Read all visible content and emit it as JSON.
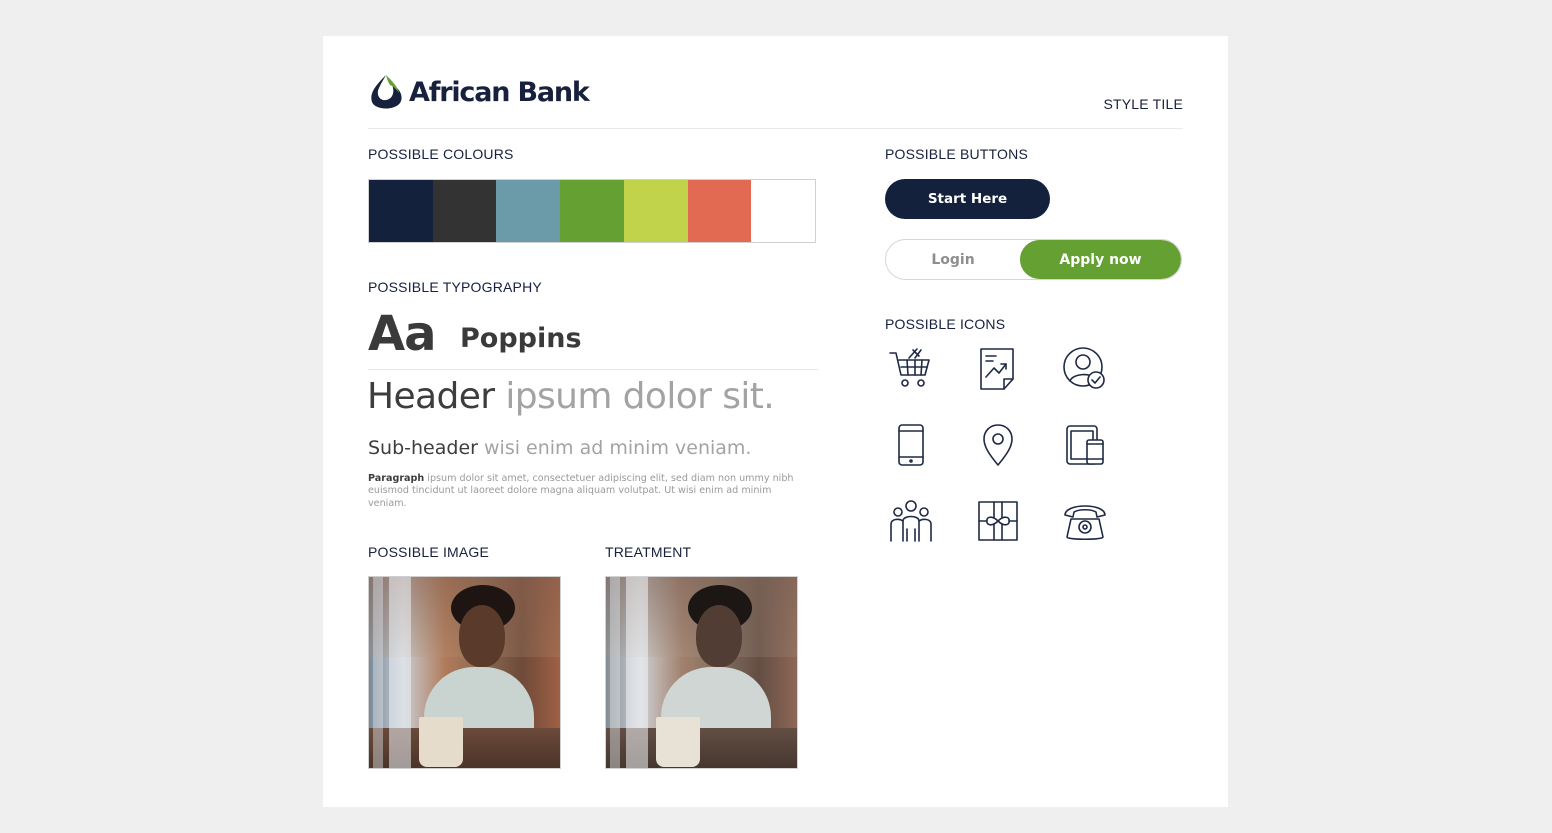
{
  "brand": {
    "name": "African Bank",
    "logo_colors": [
      "#17213d",
      "#64a032"
    ]
  },
  "tile_label": "STYLE TILE",
  "colours": {
    "label": "POSSIBLE COLOURS",
    "swatches": [
      "#13213d",
      "#333333",
      "#6b9ba9",
      "#64a032",
      "#c0d34a",
      "#e26a52",
      "#ffffff"
    ]
  },
  "typography": {
    "label": "POSSIBLE TYPOGRAPHY",
    "sample_glyph": "Aa",
    "font_name": "Poppins",
    "header_dark": "Header",
    "header_light": "ipsum dolor sit.",
    "sub_dark": "Sub-header",
    "sub_light": "wisi enim ad minim veniam.",
    "para_dark": "Paragraph",
    "para_light": "ipsum dolor sit amet, consectetuer adipiscing elit, sed diam non ummy nibh euismod tincidunt ut laoreet dolore magna aliquam volutpat. Ut wisi enim ad minim veniam."
  },
  "image": {
    "label": "POSSIBLE IMAGE"
  },
  "treatment": {
    "label": "TREATMENT"
  },
  "buttons": {
    "label": "POSSIBLE BUTTONS",
    "primary": "Start Here",
    "login": "Login",
    "apply": "Apply now",
    "primary_color": "#13213d",
    "apply_color": "#64a032"
  },
  "icons": {
    "label": "POSSIBLE ICONS",
    "items": [
      "shopping-cart-icon",
      "report-chart-icon",
      "user-check-icon",
      "mobile-phone-icon",
      "location-pin-icon",
      "devices-icon",
      "group-people-icon",
      "gift-box-icon",
      "telephone-icon"
    ]
  }
}
